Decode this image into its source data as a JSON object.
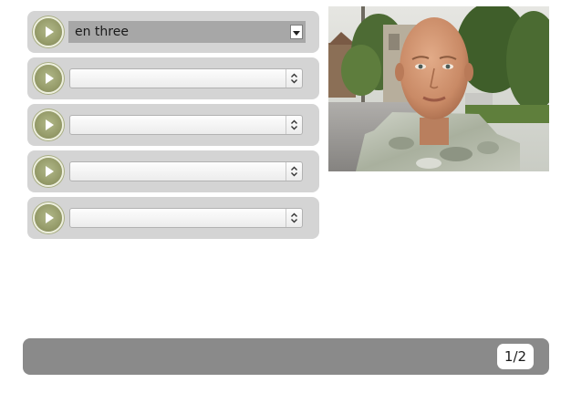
{
  "rows": [
    {
      "selected": "en three"
    },
    {
      "selected": ""
    },
    {
      "selected": ""
    },
    {
      "selected": ""
    },
    {
      "selected": ""
    }
  ],
  "icons": {
    "play": "play-icon",
    "dropdown": "chevron-down-icon",
    "select_arrows": "chevron-up-down-icon"
  },
  "colors": {
    "row_background": "#d4d4d4",
    "play_button": "#959b69",
    "footer": "#8a8a8a"
  },
  "footer": {
    "page_indicator": "1/2"
  }
}
